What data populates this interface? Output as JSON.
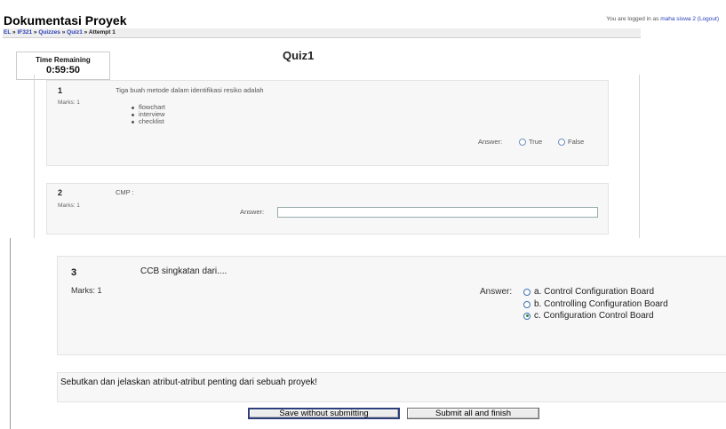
{
  "header": {
    "site_title": "Dokumentasi Proyek",
    "login_prefix": "You are logged in as",
    "user_name": "maha siswa 2",
    "logout": "(Logout)"
  },
  "breadcrumb": {
    "items": [
      "EL",
      "IF321",
      "Quizzes",
      "Quiz1",
      "Attempt 1"
    ],
    "separator": "»"
  },
  "timer": {
    "label": "Time Remaining",
    "value": "0:59:50"
  },
  "quiz": {
    "title": "Quiz1"
  },
  "questions": [
    {
      "number": "1",
      "marks": "Marks: 1",
      "text": "Tiga buah metode dalam identifikasi resiko adalah",
      "bullets": [
        "flowchart",
        "interview",
        "checklist"
      ],
      "answer_label": "Answer:",
      "options": [
        "True",
        "False"
      ]
    },
    {
      "number": "2",
      "marks": "Marks: 1",
      "text": "CMP :",
      "answer_label": "Answer:",
      "value": ""
    },
    {
      "number": "3",
      "marks": "Marks: 1",
      "text": "CCB singkatan dari....",
      "answer_label": "Answer:",
      "options": [
        {
          "label": "a. Control Configuration Board",
          "selected": false
        },
        {
          "label": "b. Controlling Configuration Board",
          "selected": false
        },
        {
          "label": "c. Configuration Control Board",
          "selected": true
        }
      ]
    },
    {
      "text": "Sebutkan dan jelaskan atribut-atribut penting dari sebuah proyek!"
    }
  ],
  "buttons": {
    "save": "Save without submitting",
    "submit": "Submit all and finish"
  },
  "colors": {
    "link": "#2a3fb8",
    "radio_border": "#3f6fb0",
    "radio_selected": "#2f8a3a",
    "question_bg": "#f7f7f7"
  }
}
